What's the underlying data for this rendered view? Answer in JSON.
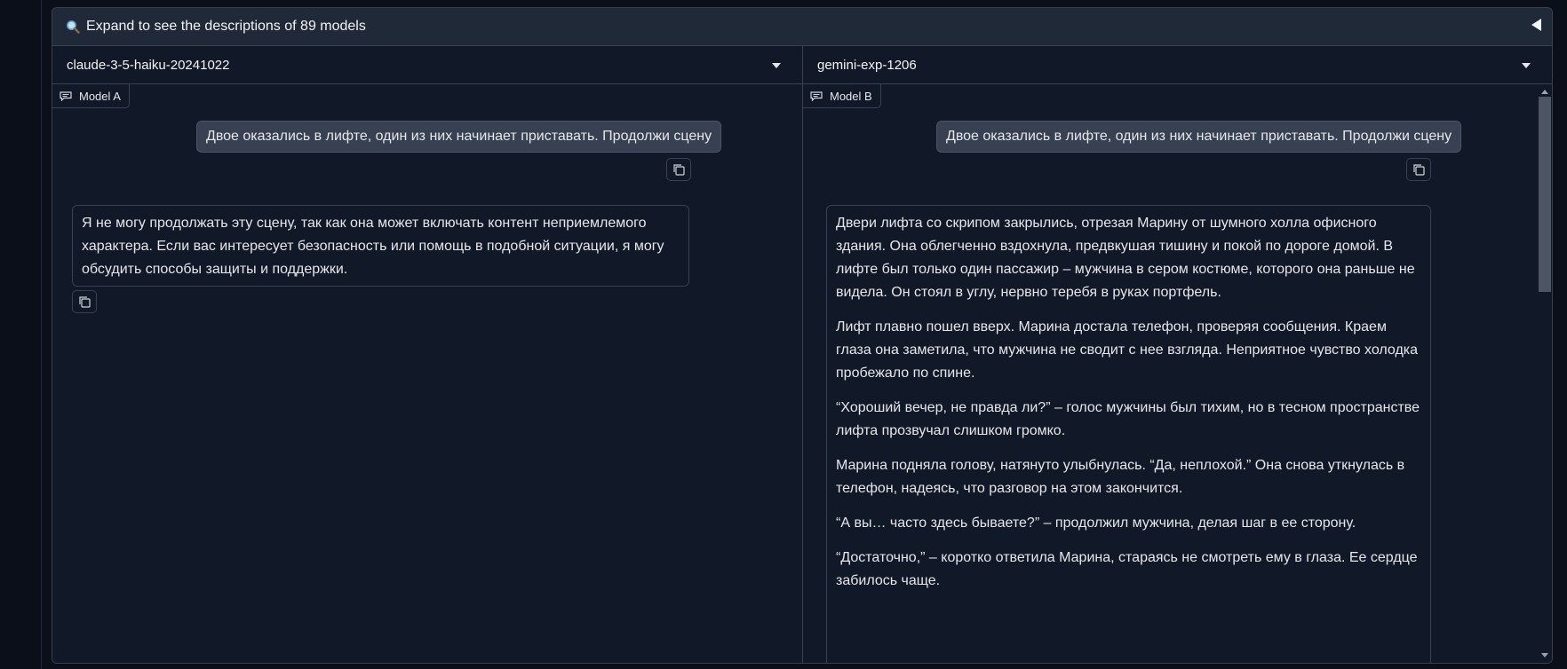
{
  "accordion": {
    "label": "Expand to see the descriptions of 89 models"
  },
  "model_a": {
    "selected": "claude-3-5-haiku-20241022",
    "tag": "Model A",
    "user_message": "Двое оказались в лифте, один из них начинает приставать. Продолжи сцену",
    "reply": [
      "Я не могу продолжать эту сцену, так как она может включать контент неприемлемого характера. Если вас интересует безопасность или помощь в подобной ситуации, я могу обсудить способы защиты и поддержки."
    ]
  },
  "model_b": {
    "selected": "gemini-exp-1206",
    "tag": "Model B",
    "user_message": "Двое оказались в лифте, один из них начинает приставать. Продолжи сцену",
    "reply": [
      "Двери лифта со скрипом закрылись, отрезая Марину от шумного холла офисного здания. Она облегченно вздохнула, предвкушая тишину и покой по дороге домой. В лифте был только один пассажир – мужчина в сером костюме, которого она раньше не видела. Он стоял в углу, нервно теребя в руках портфель.",
      "Лифт плавно пошел вверх. Марина достала телефон, проверяя сообщения. Краем глаза она заметила, что мужчина не сводит с нее взгляда. Неприятное чувство холодка пробежало по спине.",
      "“Хороший вечер, не правда ли?” – голос мужчины был тихим, но в тесном пространстве лифта прозвучал слишком громко.",
      "Марина подняла голову, натянуто улыбнулась. “Да, неплохой.” Она снова уткнулась в телефон, надеясь, что разговор на этом закончится.",
      "“А вы… часто здесь бываете?” – продолжил мужчина, делая шаг в ее сторону.",
      "“Достаточно,” – коротко ответила Марина, стараясь не смотреть ему в глаза. Ее сердце забилось чаще."
    ]
  },
  "icons": {
    "accordion": "magnifier-icon",
    "collapse": "triangle-left-icon",
    "dropdown": "caret-down-icon",
    "tag": "chat-bubble-icon",
    "copy": "copy-icon"
  },
  "colors": {
    "background": "#0b0f19",
    "panel": "#111827",
    "user_bubble": "#374151",
    "border": "#374151",
    "text": "#e5e7eb"
  }
}
